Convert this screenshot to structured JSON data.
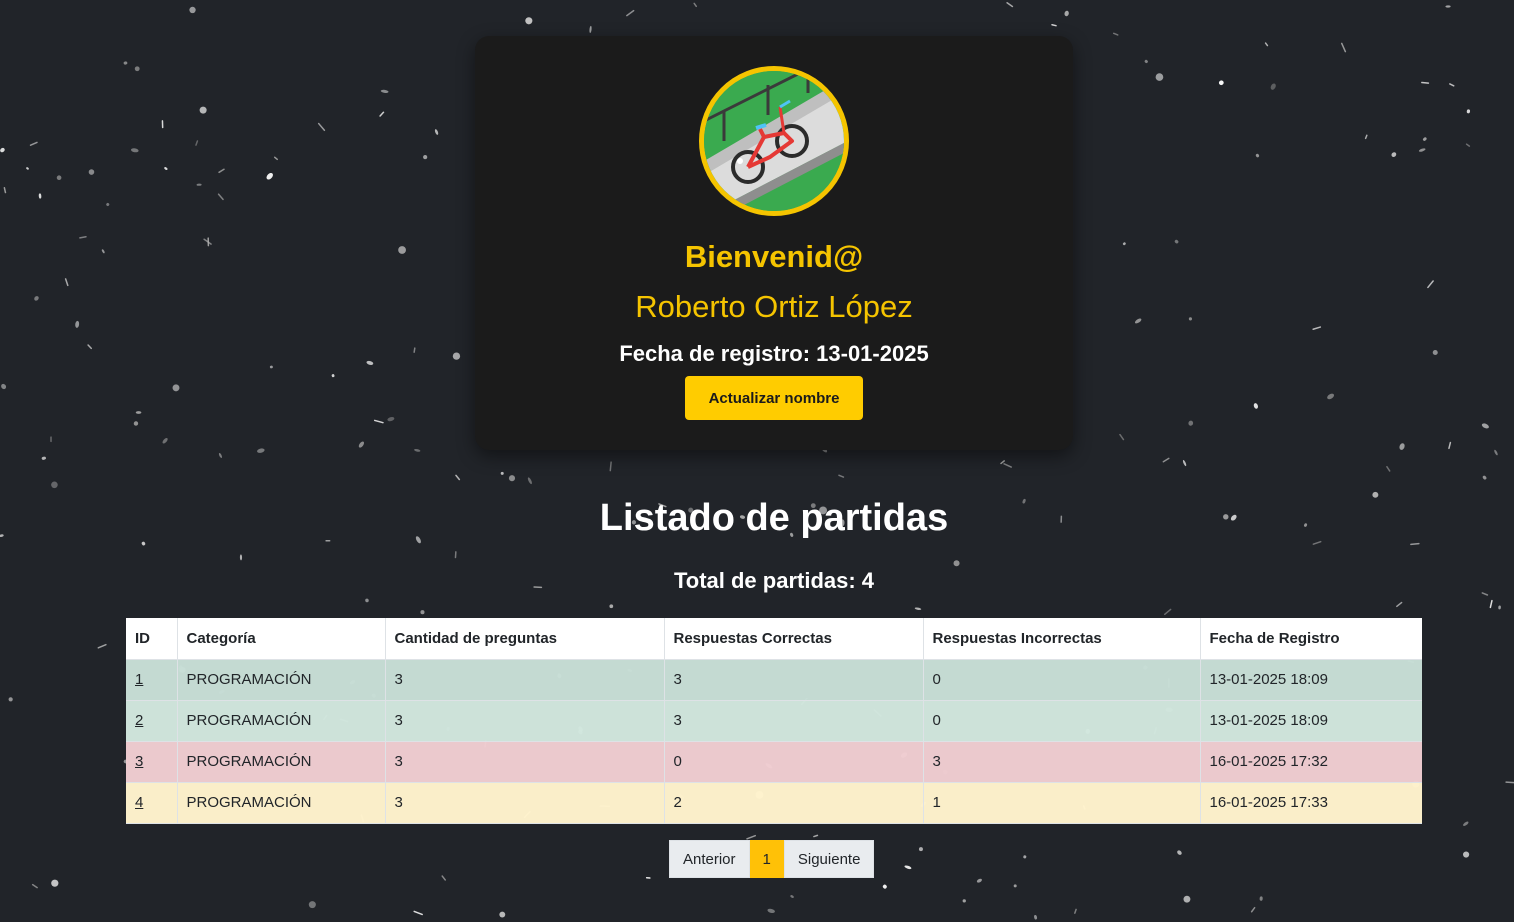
{
  "profile": {
    "avatar_alt": "bicycle-avatar",
    "welcome": "Bienvenid@",
    "name": "Roberto Ortiz López",
    "registration": "Fecha de registro: 13-01-2025",
    "update_button": "Actualizar nombre"
  },
  "games": {
    "title": "Listado de partidas",
    "total": "Total de partidas: 4",
    "columns": [
      "ID",
      "Categoría",
      "Cantidad de preguntas",
      "Respuestas Correctas",
      "Respuestas Incorrectas",
      "Fecha de Registro"
    ],
    "rows": [
      {
        "id": "1",
        "category": "PROGRAMACIÓN",
        "questions": "3",
        "correct": "3",
        "incorrect": "0",
        "date": "13-01-2025 18:09"
      },
      {
        "id": "2",
        "category": "PROGRAMACIÓN",
        "questions": "3",
        "correct": "3",
        "incorrect": "0",
        "date": "13-01-2025 18:09"
      },
      {
        "id": "3",
        "category": "PROGRAMACIÓN",
        "questions": "3",
        "correct": "0",
        "incorrect": "3",
        "date": "16-01-2025 17:32"
      },
      {
        "id": "4",
        "category": "PROGRAMACIÓN",
        "questions": "3",
        "correct": "2",
        "incorrect": "1",
        "date": "16-01-2025 17:33"
      }
    ]
  },
  "pagination": {
    "prev": "Anterior",
    "current": "1",
    "next": "Siguiente"
  },
  "colors": {
    "accent": "#f5c400",
    "button": "#ffcc00",
    "background": "#212429",
    "card": "#1b1b1b",
    "row_success_dark": "#c8ded6",
    "row_success": "#d1e7dd",
    "row_danger": "#f0cdd1",
    "row_warning": "#fff3cd"
  }
}
